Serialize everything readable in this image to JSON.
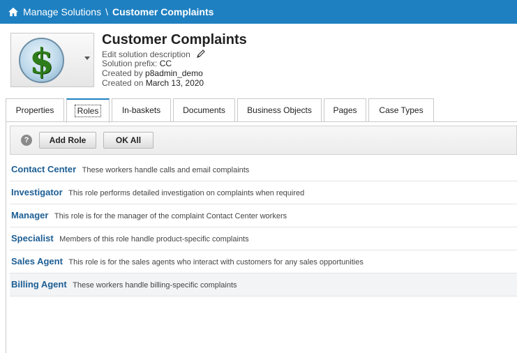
{
  "breadcrumb": {
    "home_icon": "home-icon",
    "parent": "Manage Solutions",
    "separator": "\\",
    "current": "Customer Complaints"
  },
  "solution": {
    "icon": "dollar-icon",
    "title": "Customer Complaints",
    "edit_description": "Edit solution description",
    "prefix_label": "Solution prefix:",
    "prefix_value": "CC",
    "created_by_label": "Created by",
    "created_by_value": "p8admin_demo",
    "created_on_label": "Created on",
    "created_on_value": "March 13, 2020"
  },
  "tabs": [
    {
      "label": "Properties",
      "active": false
    },
    {
      "label": "Roles",
      "active": true
    },
    {
      "label": "In-baskets",
      "active": false
    },
    {
      "label": "Documents",
      "active": false
    },
    {
      "label": "Business Objects",
      "active": false
    },
    {
      "label": "Pages",
      "active": false
    },
    {
      "label": "Case Types",
      "active": false
    }
  ],
  "toolbar": {
    "help_icon": "?",
    "add_role_label": "Add Role",
    "ok_all_label": "OK All"
  },
  "roles": [
    {
      "name": "Contact Center",
      "description": "These workers handle calls and email complaints"
    },
    {
      "name": "Investigator",
      "description": "This role performs detailed investigation on complaints when required"
    },
    {
      "name": "Manager",
      "description": "This role is for the manager of the complaint Contact Center workers"
    },
    {
      "name": "Specialist",
      "description": "Members of this role handle product-specific complaints"
    },
    {
      "name": "Sales Agent",
      "description": "This role is for the sales agents who interact with customers for any sales opportunities"
    },
    {
      "name": "Billing Agent",
      "description": "These workers handle billing-specific complaints"
    }
  ],
  "colors": {
    "topbar": "#1e80c1",
    "role_link": "#1c5e94"
  }
}
